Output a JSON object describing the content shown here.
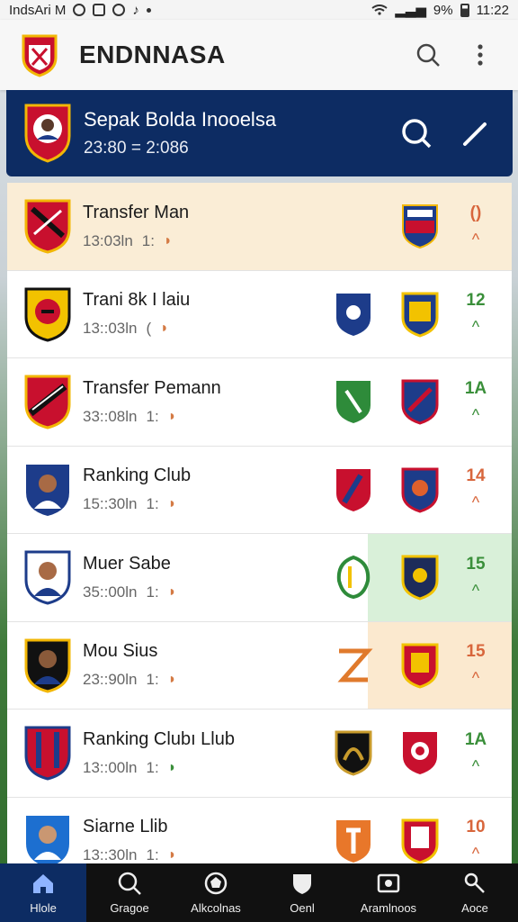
{
  "status_bar": {
    "left_text": "IndsAri M",
    "battery": "9%",
    "time": "11:22"
  },
  "app_bar": {
    "title": "ENDNNASA"
  },
  "header": {
    "title": "Sepak Bolda Inooelsa",
    "subtitle": "23:80 = 2:086"
  },
  "rows": [
    {
      "name": "Transfer Man",
      "time": "13:03ln",
      "count": "1:",
      "score": "()",
      "trend": "^",
      "trend_color": "orange",
      "score_color": "orange"
    },
    {
      "name": "Trani 8k I laiu",
      "time": "13::03ln",
      "count": "(",
      "score": "12",
      "trend": "^",
      "trend_color": "up",
      "score_color": "up"
    },
    {
      "name": "Transfer Pemann",
      "time": "33::08ln",
      "count": "1:",
      "score": "1A",
      "trend": "^",
      "trend_color": "up",
      "score_color": "up"
    },
    {
      "name": "Ranking Club",
      "time": "15::30ln",
      "count": "1:",
      "score": "14",
      "trend": "^",
      "trend_color": "orange",
      "score_color": "orange"
    },
    {
      "name": "Muer Sabe",
      "time": "35::00ln",
      "count": "1:",
      "score": "15",
      "trend": "^",
      "trend_color": "up",
      "score_color": "up"
    },
    {
      "name": "Mou Sius",
      "time": "23::90ln",
      "count": "1:",
      "score": "15",
      "trend": "^",
      "trend_color": "orange",
      "score_color": "orange"
    },
    {
      "name": "Ranking Clubı Llub",
      "time": "13::00ln",
      "count": "1:",
      "score": "1A",
      "trend": "^",
      "trend_color": "up",
      "score_color": "up"
    },
    {
      "name": "Siarne Llib",
      "time": "13::30ln",
      "count": "1:",
      "score": "10",
      "trend": "^",
      "trend_color": "orange",
      "score_color": "orange"
    }
  ],
  "bottom_nav": [
    {
      "label": "Hlole",
      "icon": "home-icon"
    },
    {
      "label": "Gragoe",
      "icon": "search-icon"
    },
    {
      "label": "Alkcolnas",
      "icon": "ball-icon"
    },
    {
      "label": "Oenl",
      "icon": "shield-icon"
    },
    {
      "label": "Aramlnoos",
      "icon": "gallery-icon"
    },
    {
      "label": "Aoce",
      "icon": "key-icon"
    }
  ],
  "colors": {
    "header_bg": "#0d2c63",
    "nav_active": "#0d2c63",
    "highlight_row": "#faedd6",
    "green_tint": "#d9f0d9",
    "orange_tint": "#fbe9cf"
  }
}
